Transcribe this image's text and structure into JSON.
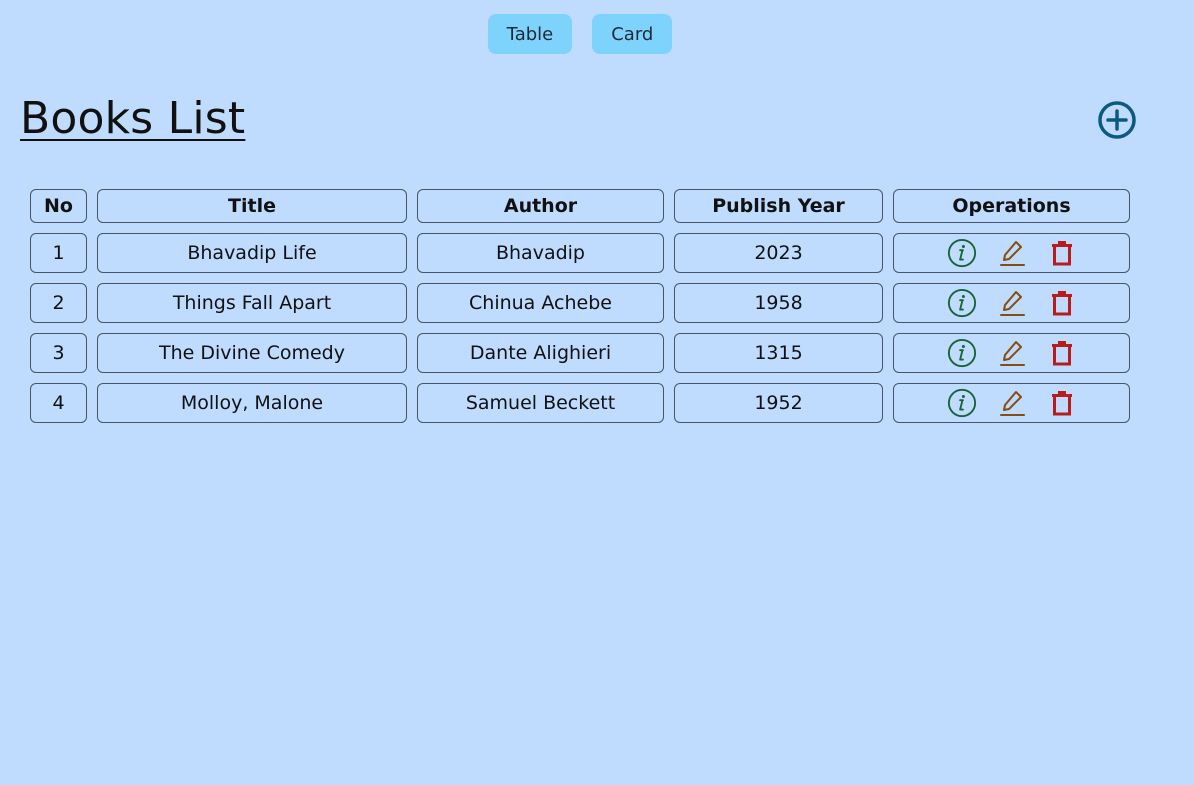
{
  "view_toggle": {
    "table_label": "Table",
    "card_label": "Card"
  },
  "header": {
    "title": "Books List",
    "add_icon": "plus-circle-icon"
  },
  "table": {
    "columns": [
      "No",
      "Title",
      "Author",
      "Publish Year",
      "Operations"
    ],
    "rows": [
      {
        "no": "1",
        "title": "Bhavadip Life",
        "author": "Bhavadip",
        "year": "2023"
      },
      {
        "no": "2",
        "title": "Things Fall Apart",
        "author": "Chinua Achebe",
        "year": "1958"
      },
      {
        "no": "3",
        "title": "The Divine Comedy",
        "author": "Dante Alighieri",
        "year": "1315"
      },
      {
        "no": "4",
        "title": "Molloy, Malone",
        "author": "Samuel Beckett",
        "year": "1952"
      }
    ],
    "operation_icons": [
      "info-icon",
      "edit-icon",
      "delete-icon"
    ]
  },
  "colors": {
    "background": "#bfdbfe",
    "toggle_button": "#7dd3fc",
    "add_icon": "#0c5a80",
    "info_icon": "#166534",
    "edit_icon": "#854d0e",
    "delete_icon": "#b91c1c"
  }
}
